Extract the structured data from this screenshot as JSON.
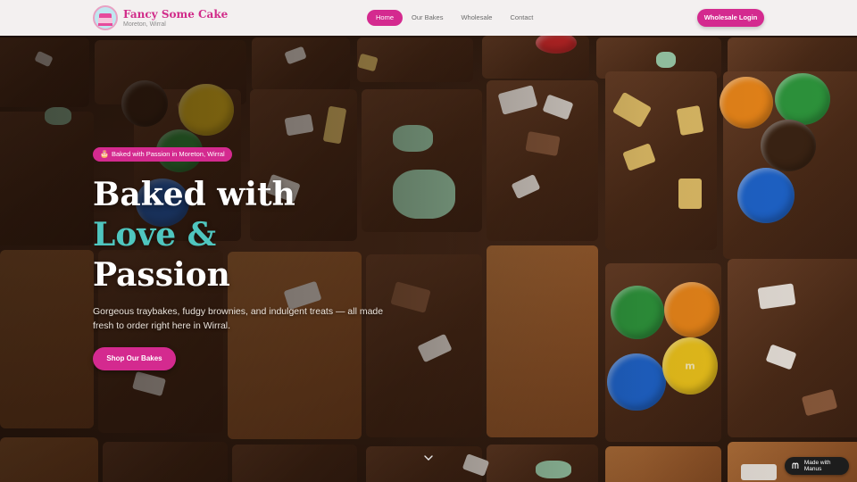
{
  "brand": {
    "name": "Fancy Some Cake",
    "location": "Moreton, Wirral"
  },
  "nav": {
    "items": [
      {
        "label": "Home",
        "active": true
      },
      {
        "label": "Our Bakes",
        "active": false
      },
      {
        "label": "Wholesale",
        "active": false
      },
      {
        "label": "Contact",
        "active": false
      }
    ],
    "cta_label": "Wholesale Login"
  },
  "hero": {
    "badge_icon": "🎂",
    "badge_text": "Baked with Passion in Moreton, Wirral",
    "headline_line1": "Baked with",
    "headline_line2": "Love &",
    "headline_line3": "Passion",
    "subtext": "Gorgeous traybakes, fudgy brownies, and indulgent treats — all made fresh to order right here in Wirral.",
    "cta_label": "Shop Our Bakes",
    "scroll_icon": "chevron-down-icon"
  },
  "footer_badge": {
    "label": "Made with Manus",
    "icon": "manus-icon"
  },
  "colors": {
    "brand_pink": "#d42a8f",
    "accent_teal": "#4fc6bf"
  }
}
